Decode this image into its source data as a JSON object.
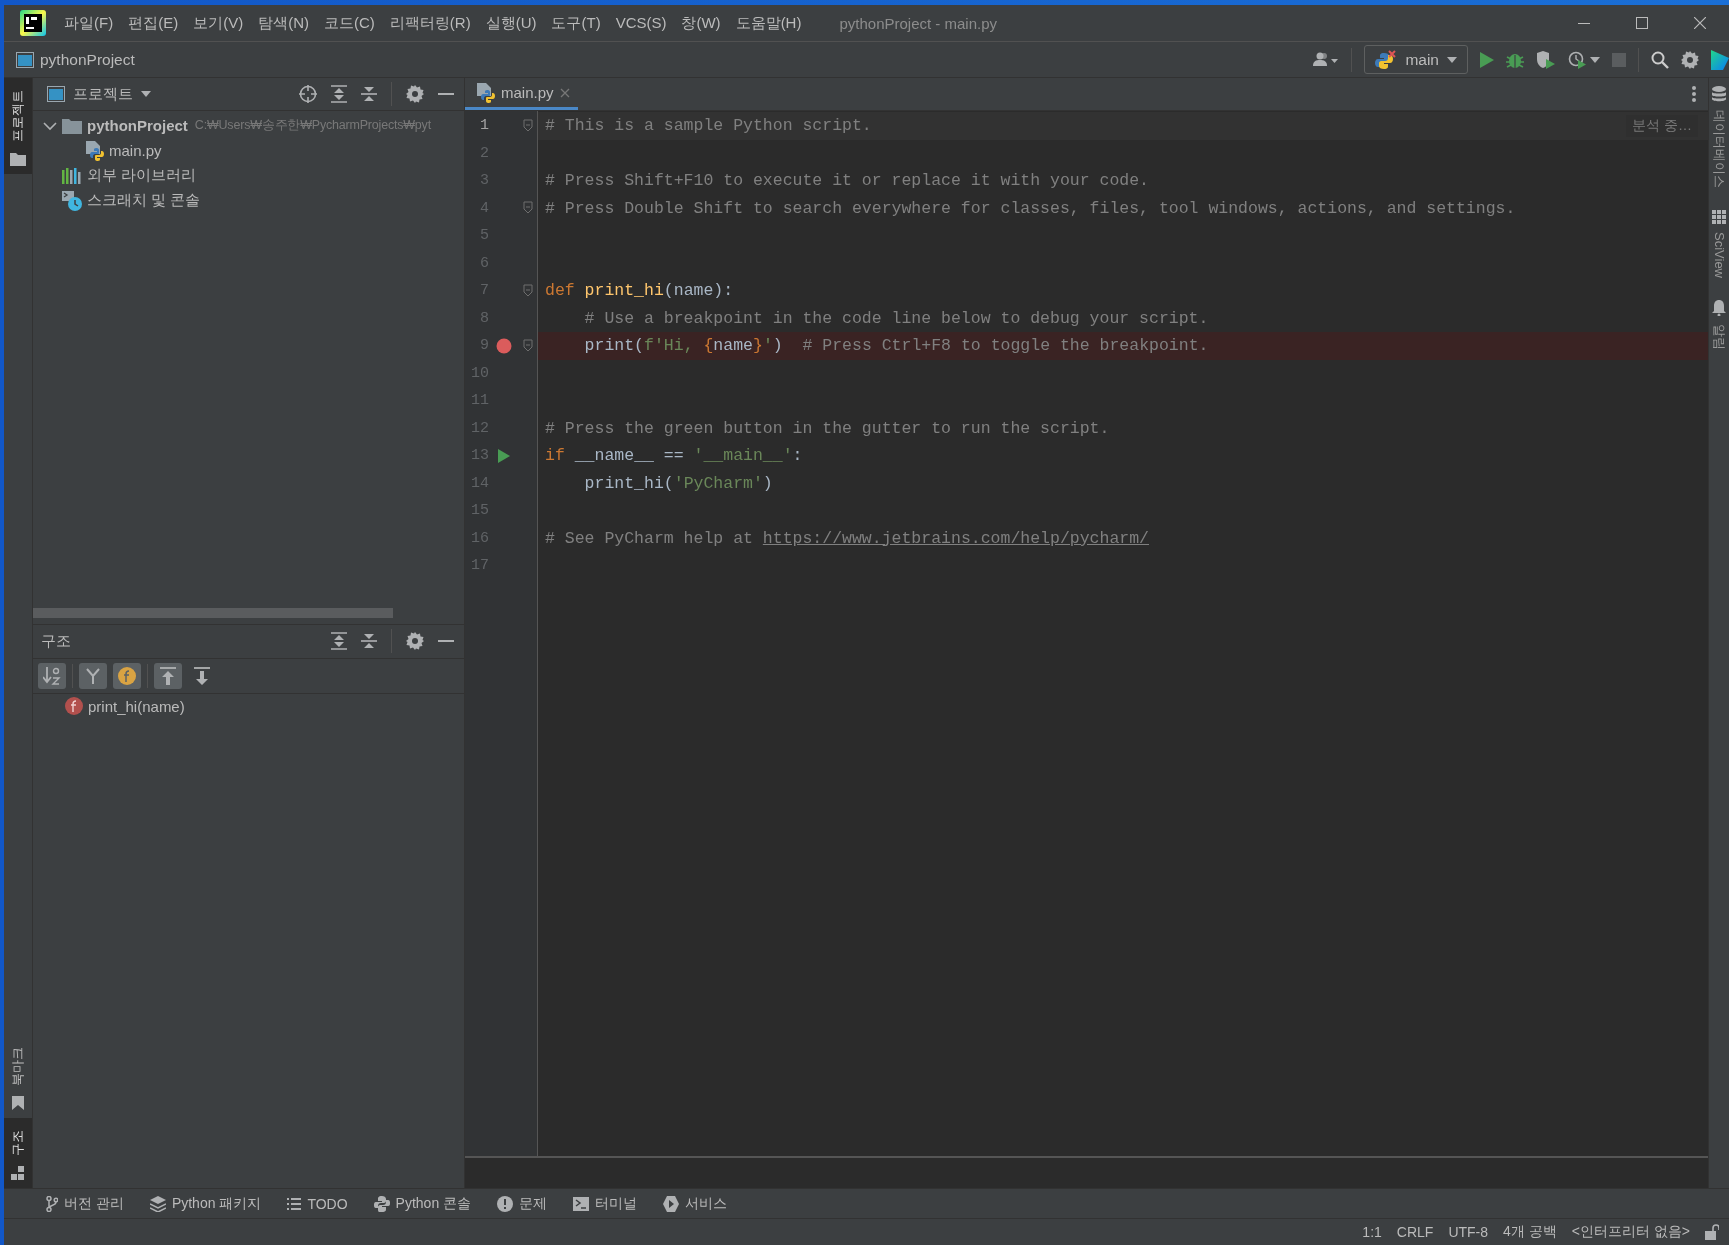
{
  "window": {
    "title": "pythonProject - main.py"
  },
  "menu": [
    "파일(F)",
    "편집(E)",
    "보기(V)",
    "탐색(N)",
    "코드(C)",
    "리팩터링(R)",
    "실행(U)",
    "도구(T)",
    "VCS(S)",
    "창(W)",
    "도움말(H)"
  ],
  "navbar": {
    "project": "pythonProject",
    "run_config": "main"
  },
  "left_strip": {
    "top": [
      {
        "label": "프로젝트",
        "kind": "project",
        "selected": true
      }
    ],
    "bottom": [
      {
        "label": "북마크",
        "kind": "bookmarks",
        "selected": false
      },
      {
        "label": "구조",
        "kind": "structure",
        "selected": true
      }
    ]
  },
  "project_panel": {
    "title": "프로젝트",
    "tree": [
      {
        "label": "pythonProject",
        "kind": "folder",
        "path": "C:₩Users₩송주한₩PycharmProjects₩pyt",
        "expanded": true,
        "children": [
          {
            "label": "main.py",
            "kind": "python-file"
          }
        ]
      },
      {
        "label": "외부 라이브러리",
        "kind": "library"
      },
      {
        "label": "스크래치 및 콘솔",
        "kind": "scratch"
      }
    ]
  },
  "structure_panel": {
    "title": "구조",
    "toolbar": [
      {
        "kind": "sort",
        "selected": true
      },
      {
        "kind": "inherited",
        "selected": true
      },
      {
        "kind": "fields",
        "selected": true
      },
      {
        "kind": "expand",
        "selected": true
      },
      {
        "kind": "collapse",
        "selected": false
      }
    ],
    "items": [
      {
        "label": "print_hi(name)",
        "kind": "function"
      }
    ]
  },
  "editor": {
    "tabs": [
      {
        "label": "main.py",
        "selected": true
      }
    ],
    "status_badge": "분석 중…",
    "lines": [
      {
        "number": "1",
        "current": true,
        "fold": true,
        "breakpoint": false,
        "run": false,
        "tokens": [
          {
            "kind": "comment",
            "text": "# This is a sample Python script."
          }
        ]
      },
      {
        "number": "2",
        "current": false,
        "fold": false,
        "breakpoint": false,
        "run": false
      },
      {
        "number": "3",
        "current": false,
        "fold": false,
        "breakpoint": false,
        "run": false,
        "tokens": [
          {
            "kind": "comment",
            "text": "# Press Shift+F10 to execute it or replace it with your code."
          }
        ]
      },
      {
        "number": "4",
        "current": false,
        "fold": true,
        "breakpoint": false,
        "run": false,
        "tokens": [
          {
            "kind": "comment",
            "text": "# Press Double Shift to search everywhere for classes, files, tool windows, actions, and settings."
          }
        ]
      },
      {
        "number": "5",
        "current": false,
        "fold": false,
        "breakpoint": false,
        "run": false
      },
      {
        "number": "6",
        "current": false,
        "fold": false,
        "breakpoint": false,
        "run": false
      },
      {
        "number": "7",
        "current": false,
        "fold": true,
        "breakpoint": false,
        "run": false,
        "tokens": [
          {
            "kind": "keyword",
            "text": "def "
          },
          {
            "kind": "function",
            "text": "print_hi"
          },
          {
            "kind": "plain",
            "text": "(name):"
          }
        ]
      },
      {
        "number": "8",
        "current": false,
        "fold": false,
        "breakpoint": false,
        "run": false,
        "tokens": [
          {
            "kind": "comment",
            "text": "    # Use a breakpoint in the code line below to debug your script."
          }
        ]
      },
      {
        "number": "9",
        "current": false,
        "fold": true,
        "breakpoint": true,
        "run": false,
        "tokens": [
          {
            "kind": "plain",
            "text": "    print("
          },
          {
            "kind": "string",
            "text": "f'Hi, "
          },
          {
            "kind": "brace",
            "text": "{"
          },
          {
            "kind": "plain",
            "text": "name"
          },
          {
            "kind": "brace",
            "text": "}"
          },
          {
            "kind": "string",
            "text": "'"
          },
          {
            "kind": "plain",
            "text": ")  "
          },
          {
            "kind": "comment",
            "text": "# Press Ctrl+F8 to toggle the breakpoint."
          }
        ]
      },
      {
        "number": "10",
        "current": false,
        "fold": false,
        "breakpoint": false,
        "run": false
      },
      {
        "number": "11",
        "current": false,
        "fold": false,
        "breakpoint": false,
        "run": false
      },
      {
        "number": "12",
        "current": false,
        "fold": false,
        "breakpoint": false,
        "run": false,
        "tokens": [
          {
            "kind": "comment",
            "text": "# Press the green button in the gutter to run the script."
          }
        ]
      },
      {
        "number": "13",
        "current": false,
        "fold": false,
        "breakpoint": false,
        "run": true,
        "tokens": [
          {
            "kind": "keyword",
            "text": "if "
          },
          {
            "kind": "plain",
            "text": "__name__ == "
          },
          {
            "kind": "string",
            "text": "'__main__'"
          },
          {
            "kind": "plain",
            "text": ":"
          }
        ]
      },
      {
        "number": "14",
        "current": false,
        "fold": false,
        "breakpoint": false,
        "run": false,
        "tokens": [
          {
            "kind": "plain",
            "text": "    print_hi("
          },
          {
            "kind": "string",
            "text": "'PyCharm'"
          },
          {
            "kind": "plain",
            "text": ")"
          }
        ]
      },
      {
        "number": "15",
        "current": false,
        "fold": false,
        "breakpoint": false,
        "run": false
      },
      {
        "number": "16",
        "current": false,
        "fold": false,
        "breakpoint": false,
        "run": false,
        "tokens": [
          {
            "kind": "comment",
            "text": "# See PyCharm help at "
          },
          {
            "kind": "link",
            "text": "https://www.jetbrains.com/help/pycharm/"
          }
        ]
      },
      {
        "number": "17",
        "current": false,
        "fold": false,
        "breakpoint": false,
        "run": false
      }
    ]
  },
  "right_strip": [
    {
      "label": "데이터베이스",
      "kind": "database"
    },
    {
      "label": "SciView",
      "kind": "sciview"
    },
    {
      "label": "알림",
      "kind": "notifications"
    }
  ],
  "tool_tabs": [
    {
      "label": "버전 관리",
      "kind": "vcs"
    },
    {
      "label": "Python 패키지",
      "kind": "packages"
    },
    {
      "label": "TODO",
      "kind": "todo"
    },
    {
      "label": "Python 콘솔",
      "kind": "console"
    },
    {
      "label": "문제",
      "kind": "problems"
    },
    {
      "label": "터미널",
      "kind": "terminal"
    },
    {
      "label": "서비스",
      "kind": "services"
    }
  ],
  "status_bar": [
    "1:1",
    "CRLF",
    "UTF-8",
    "4개 공백",
    "<인터프리터 없음>"
  ]
}
